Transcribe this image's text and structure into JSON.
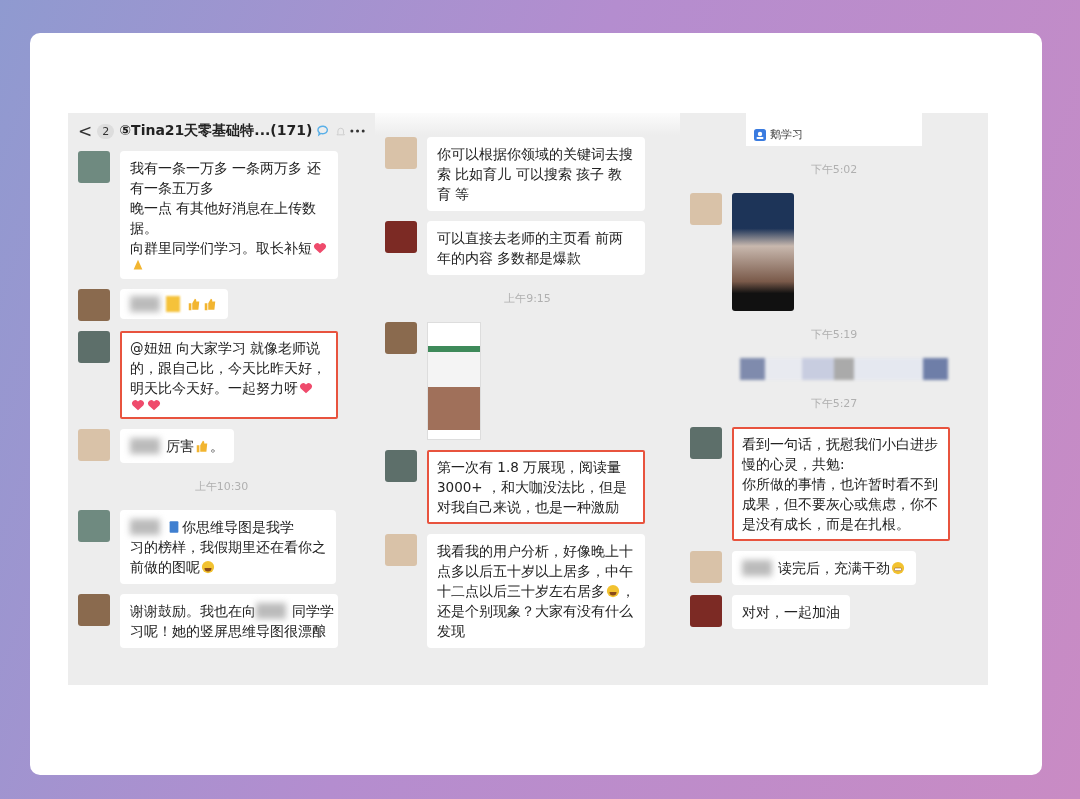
{
  "panels": [
    {
      "header": {
        "back": "<",
        "badge": "2",
        "title": "⑤Tina21天零基础特...(171)"
      },
      "messages": [
        {
          "kind": "text",
          "highlighted": false,
          "parts": [
            {
              "kind": "text",
              "text": "我有一条一万多 一条两万多 还有一条五万多"
            },
            {
              "kind": "text",
              "text": "晚一点 有其他好消息在上传数据。"
            },
            {
              "kind": "line",
              "items": [
                {
                  "kind": "text",
                  "text": "向群里同学们学习。取长补短"
                },
                {
                  "kind": "heart"
                }
              ]
            },
            {
              "kind": "line",
              "items": [
                {
                  "kind": "pray"
                }
              ]
            }
          ]
        },
        {
          "kind": "text",
          "highlighted": false,
          "parts": [
            {
              "kind": "line",
              "items": [
                {
                  "kind": "blur"
                },
                {
                  "kind": "yellow_blur"
                },
                {
                  "kind": "thumbs_up"
                },
                {
                  "kind": "thumbs_up"
                }
              ]
            }
          ]
        },
        {
          "kind": "text",
          "highlighted": true,
          "parts": [
            {
              "kind": "text",
              "text": "@妞妞 向大家学习 就像老师说的，跟自己比，今天比昨天好，"
            },
            {
              "kind": "line",
              "items": [
                {
                  "kind": "text",
                  "text": "明天比今天好。一起努力呀"
                },
                {
                  "kind": "heart"
                }
              ]
            },
            {
              "kind": "line",
              "items": [
                {
                  "kind": "heart"
                },
                {
                  "kind": "heart"
                }
              ]
            }
          ]
        },
        {
          "kind": "text",
          "highlighted": false,
          "parts": [
            {
              "kind": "line",
              "items": [
                {
                  "kind": "blur"
                },
                {
                  "kind": "text",
                  "text": "厉害"
                },
                {
                  "kind": "thumbs_up"
                },
                {
                  "kind": "text",
                  "text": "。"
                }
              ]
            }
          ]
        },
        {
          "kind": "time",
          "text": "上午10:30"
        },
        {
          "kind": "text",
          "highlighted": false,
          "parts": [
            {
              "kind": "line",
              "items": [
                {
                  "kind": "blur"
                },
                {
                  "kind": "book"
                },
                {
                  "kind": "text",
                  "text": "你思维导图是我学"
                }
              ]
            },
            {
              "kind": "text",
              "text": "习的榜样，我假期里还在看你之"
            },
            {
              "kind": "line",
              "items": [
                {
                  "kind": "text",
                  "text": "前做的图呢"
                },
                {
                  "kind": "laugh"
                }
              ]
            }
          ]
        },
        {
          "kind": "text",
          "highlighted": false,
          "parts": [
            {
              "kind": "line",
              "items": [
                {
                  "kind": "text",
                  "text": "谢谢鼓励。我也在向"
                },
                {
                  "kind": "blur"
                },
                {
                  "kind": "text",
                  "text": "同学学"
                }
              ]
            },
            {
              "kind": "text",
              "text": "习呢！她的竖屏思维导图很漂酿"
            }
          ]
        }
      ]
    },
    {
      "messages": [
        {
          "kind": "text",
          "highlighted": false,
          "parts": [
            {
              "kind": "text",
              "text": "你可以根据你领域的关键词去搜索  比如育儿 可以搜索 孩子 教育 等"
            }
          ]
        },
        {
          "kind": "text",
          "highlighted": false,
          "parts": [
            {
              "kind": "text",
              "text": "可以直接去老师的主页看   前两年的内容 多数都是爆款"
            }
          ]
        },
        {
          "kind": "time",
          "text": "上午9:15"
        },
        {
          "kind": "screenshot"
        },
        {
          "kind": "text",
          "highlighted": true,
          "parts": [
            {
              "kind": "text",
              "text": "第一次有 1.8 万展现，阅读量 3000+ ，和大咖没法比，但是对我自己来说，也是一种激励"
            }
          ]
        },
        {
          "kind": "text",
          "highlighted": false,
          "parts": [
            {
              "kind": "text",
              "text": "我看我的用户分析，好像晚上十点多以后五十岁以上居多，中午"
            },
            {
              "kind": "line",
              "items": [
                {
                  "kind": "text",
                  "text": "十二点以后三十岁左右居多"
                },
                {
                  "kind": "laugh"
                },
                {
                  "kind": "text",
                  "text": "，"
                }
              ]
            },
            {
              "kind": "text",
              "text": "还是个别现象？大家有没有什么发现"
            }
          ]
        }
      ]
    },
    {
      "messages": [
        {
          "kind": "card",
          "label": "鹅学习"
        },
        {
          "kind": "time",
          "text": "下午5:02"
        },
        {
          "kind": "photo"
        },
        {
          "kind": "time",
          "text": "下午5:19"
        },
        {
          "kind": "blurred_image"
        },
        {
          "kind": "time",
          "text": "下午5:27"
        },
        {
          "kind": "text",
          "highlighted": true,
          "parts": [
            {
              "kind": "text",
              "text": "看到一句话，抚慰我们小白进步慢的心灵，共勉:"
            },
            {
              "kind": "text",
              "text": "你所做的事情，也许暂时看不到成果，但不要灰心或焦虑，你不是没有成长，而是在扎根。"
            }
          ]
        },
        {
          "kind": "text",
          "highlighted": false,
          "parts": [
            {
              "kind": "line",
              "items": [
                {
                  "kind": "blur"
                },
                {
                  "kind": "text",
                  "text": "读完后，充满干劲"
                },
                {
                  "kind": "grin"
                }
              ]
            }
          ]
        },
        {
          "kind": "text",
          "highlighted": false,
          "parts": [
            {
              "kind": "text",
              "text": "对对，一起加油"
            }
          ]
        }
      ]
    }
  ]
}
